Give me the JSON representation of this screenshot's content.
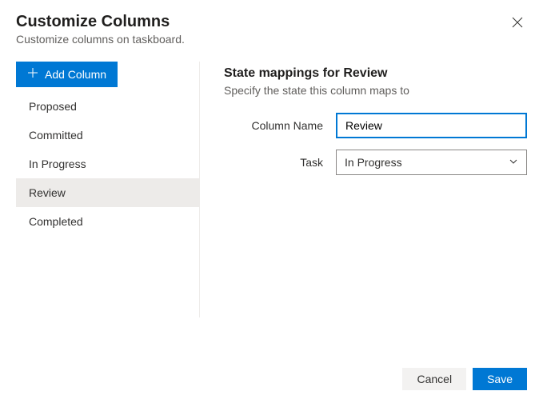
{
  "header": {
    "title": "Customize Columns",
    "subtitle": "Customize columns on taskboard."
  },
  "sidebar": {
    "add_label": "Add Column",
    "items": [
      {
        "label": "Proposed"
      },
      {
        "label": "Committed"
      },
      {
        "label": "In Progress"
      },
      {
        "label": "Review"
      },
      {
        "label": "Completed"
      }
    ],
    "selected_index": 3
  },
  "main": {
    "heading": "State mappings for Review",
    "subtitle": "Specify the state this column maps to",
    "column_name_label": "Column Name",
    "column_name_value": "Review",
    "task_label": "Task",
    "task_value": "In Progress"
  },
  "footer": {
    "cancel": "Cancel",
    "save": "Save"
  }
}
